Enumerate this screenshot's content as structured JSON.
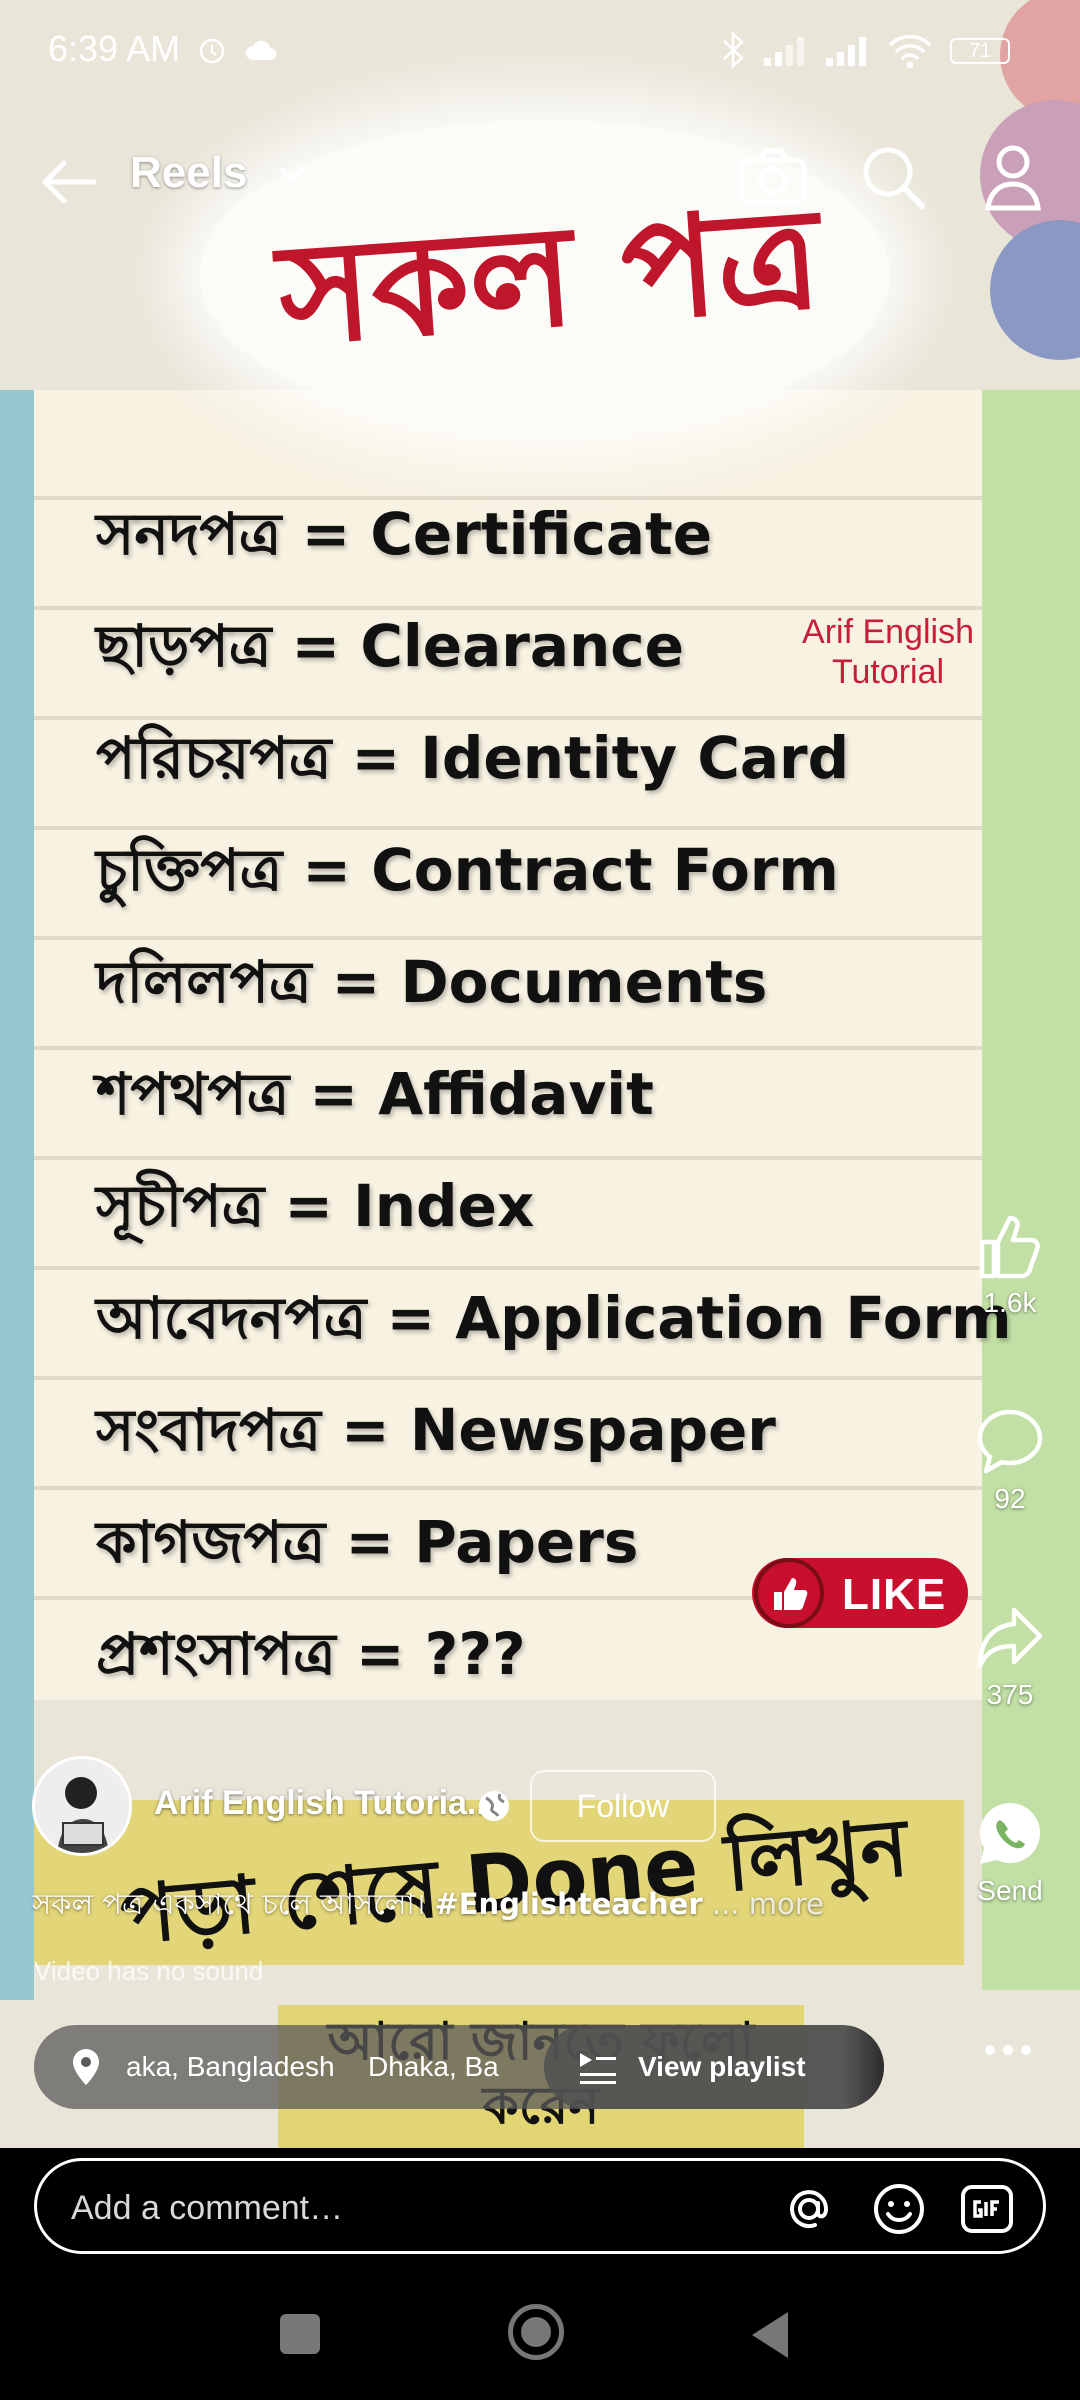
{
  "status_bar": {
    "time": "6:39 AM",
    "battery": "71"
  },
  "top_bar": {
    "title": "Reels"
  },
  "video": {
    "heading": "সকল পত্র",
    "vocab": [
      "সনদপত্র = Certificate",
      "ছাড়পত্র = Clearance",
      "পরিচয়পত্র = Identity Card",
      "চুক্তিপত্র = Contract Form",
      "দলিলপত্র = Documents",
      "শপথপত্র = Affidavit",
      "সূচীপত্র = Index",
      "আবেদনপত্র = Application Form",
      "সংবাদপত্র = Newspaper",
      "কাগজপত্র = Papers",
      "প্রশংসাপত্র = ???"
    ],
    "watermark_line1": "Arif English",
    "watermark_line2": "Tutorial",
    "like_badge": "LIKE",
    "banner1": "পড়া শেষে Done লিখুন",
    "banner2_line1": "আরো জানতে ফলো",
    "banner2_line2": "করেন"
  },
  "actions": {
    "likes": "1.6k",
    "comments": "92",
    "shares": "375",
    "send": "Send"
  },
  "author": {
    "name": "Arif English Tutoria...",
    "follow": "Follow"
  },
  "caption": {
    "text": "সকল পত্র একসাথে চলে আসলো। ",
    "hashtag": "#Englishteacher",
    "more": " ... more"
  },
  "sound_note": "Video has no sound",
  "chips": {
    "location1": "aka, Bangladesh",
    "location2": "Dhaka, Ba",
    "playlist": "View playlist"
  },
  "comment": {
    "placeholder": "Add a comment…"
  },
  "colors": {
    "title_red": "#c0162c",
    "like_red": "#c8102e",
    "banner_yellow": "#e2d46f"
  }
}
